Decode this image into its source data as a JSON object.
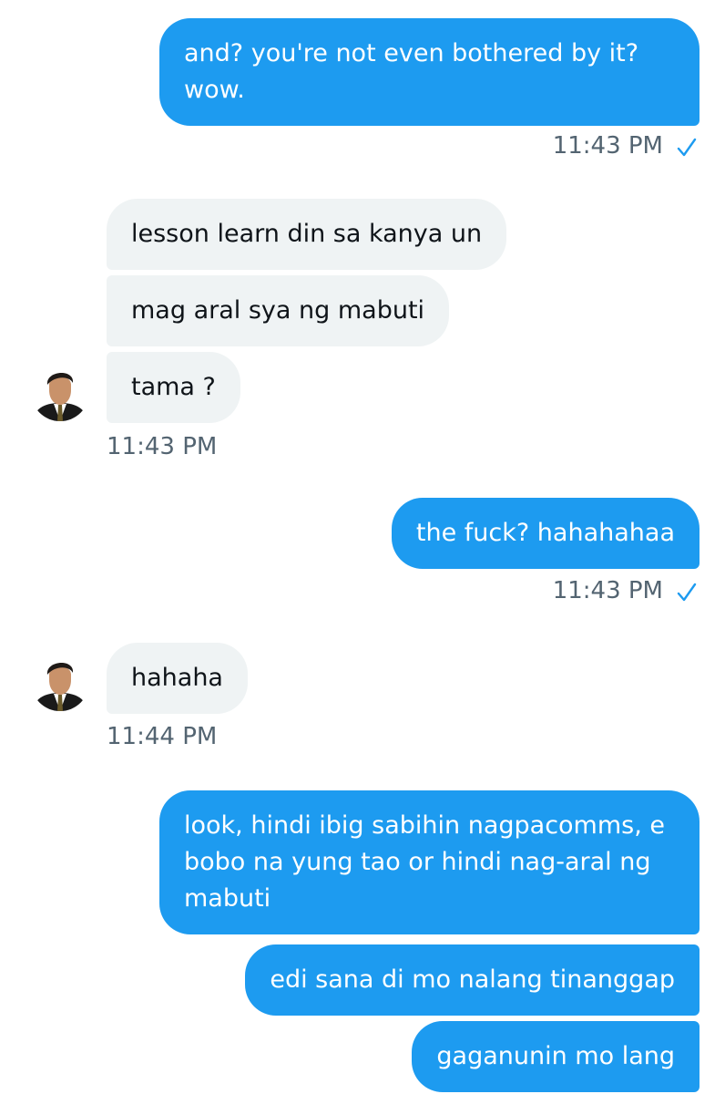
{
  "messages": [
    {
      "direction": "sent",
      "text": "and? you're not even bothered by it?\nwow."
    },
    {
      "direction": "sent-time",
      "time": "11:43 PM"
    },
    {
      "direction": "received",
      "text": "lesson learn din sa kanya un"
    },
    {
      "direction": "received",
      "text": "mag aral sya ng mabuti"
    },
    {
      "direction": "received",
      "text": "tama ?"
    },
    {
      "direction": "received-time",
      "time": "11:43 PM"
    },
    {
      "direction": "sent",
      "text": "the fuck? hahahahaa"
    },
    {
      "direction": "sent-time",
      "time": "11:43 PM"
    },
    {
      "direction": "received",
      "text": "hahaha"
    },
    {
      "direction": "received-time",
      "time": "11:44 PM"
    },
    {
      "direction": "sent",
      "text": "look, hindi ibig sabihin nagpacomms, e bobo na yung tao or hindi nag-aral ng mabuti"
    },
    {
      "direction": "sent",
      "text": "edi sana di mo nalang tinanggap"
    },
    {
      "direction": "sent",
      "text": "gaganunin mo lang"
    }
  ],
  "icons": {
    "read_receipt": "check-icon",
    "avatar": "avatar-icon"
  },
  "colors": {
    "sent_bubble": "#1d9bf0",
    "received_bubble": "#eff3f4",
    "timestamp": "#536471",
    "check": "#1d9bf0"
  }
}
